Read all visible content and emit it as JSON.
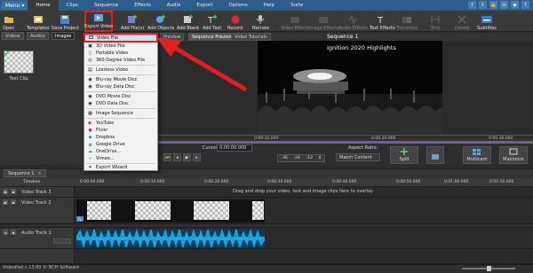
{
  "menu_button": "Menu ▾",
  "menu_tabs": [
    "Home",
    "Clips",
    "Sequence",
    "Effects",
    "Audio",
    "Export",
    "Options",
    "Help",
    "Suite"
  ],
  "ribbon": [
    {
      "label": "Open",
      "icon": "folder-open-icon"
    },
    {
      "label": "Templates",
      "icon": "templates-icon"
    },
    {
      "label": "Save Project",
      "icon": "save-icon"
    },
    {
      "label": "Export Video",
      "icon": "export-video-icon"
    },
    {
      "label": "Add File(s)",
      "icon": "add-file-icon"
    },
    {
      "label": "Add Objects",
      "icon": "add-objects-icon"
    },
    {
      "label": "Add Blank",
      "icon": "add-blank-icon"
    },
    {
      "label": "Add Text",
      "icon": "add-text-icon"
    },
    {
      "label": "Record",
      "icon": "record-icon"
    },
    {
      "label": "Narrate",
      "icon": "microphone-icon"
    },
    {
      "label": "Video Effects",
      "icon": "video-effects-icon"
    },
    {
      "label": "Image Effects",
      "icon": "image-effects-icon"
    },
    {
      "label": "Audio Effects",
      "icon": "audio-effects-icon"
    },
    {
      "label": "Text Effects",
      "icon": "text-effects-icon"
    },
    {
      "label": "Transition",
      "icon": "transition-icon"
    },
    {
      "label": "Trim",
      "icon": "trim-icon"
    },
    {
      "label": "Delete",
      "icon": "delete-icon"
    },
    {
      "label": "Subtitles",
      "icon": "subtitles-icon"
    }
  ],
  "left_tabs": [
    "Videos",
    "Audios",
    "Images"
  ],
  "clip_label": "Text Clip",
  "export_menu": [
    "Video File",
    "3D Video File",
    "Portable Video",
    "360-Degree Video File",
    "Lossless Video",
    "Blu-ray Movie Disc",
    "Blu-ray Data Disc",
    "DVD Movie Disc",
    "DVD Data Disc",
    "Image Sequence",
    "YouTube",
    "Flickr",
    "Dropbox",
    "Google Drive",
    "OneDrive...",
    "Vimeo...",
    "Export Wizard"
  ],
  "preview_tabs": [
    "Preview",
    "Sequence Preview",
    "Video Tutorials"
  ],
  "sequence_title": "Sequence 1",
  "overlay_text": "Ignition 2020 Highlights",
  "preview_ruler": [
    "0:00:10.000",
    "0:00:20.000",
    "0:00:30.000"
  ],
  "cursor_label": "Cursor:",
  "cursor_value": "0:00:00.000",
  "aspect_label": "Aspect Ratio:",
  "aspect_value": "Match Content",
  "volume_marks": [
    "-36",
    "-24",
    "-12",
    "0"
  ],
  "split_label": "Split",
  "multicam_label": "Multicam",
  "maximize_label": "Maximize",
  "sequence_tab": "Sequence 1",
  "timeline_label": "Timeline",
  "timeline_ruler": [
    "0:00:00.000",
    "0:00:10.000",
    "0:00:20.000",
    "0:00:30.000",
    "0:00:40.000",
    "0:00:50.000",
    "0:01:00.000",
    "0:01:10.000"
  ],
  "tracks": [
    "Video Track 3",
    "Video Track 2",
    "Audio Track 1"
  ],
  "drag_hint": "Drag and drop your video, text and image clips here to overlay",
  "status_text": "VideoPad v 13.00 © NCH Software",
  "colors": {
    "accent": "#2f5e8c",
    "highlight_red": "#e02020",
    "timeline_purple": "#7a55b8",
    "waveform": "#1aa7e0"
  }
}
